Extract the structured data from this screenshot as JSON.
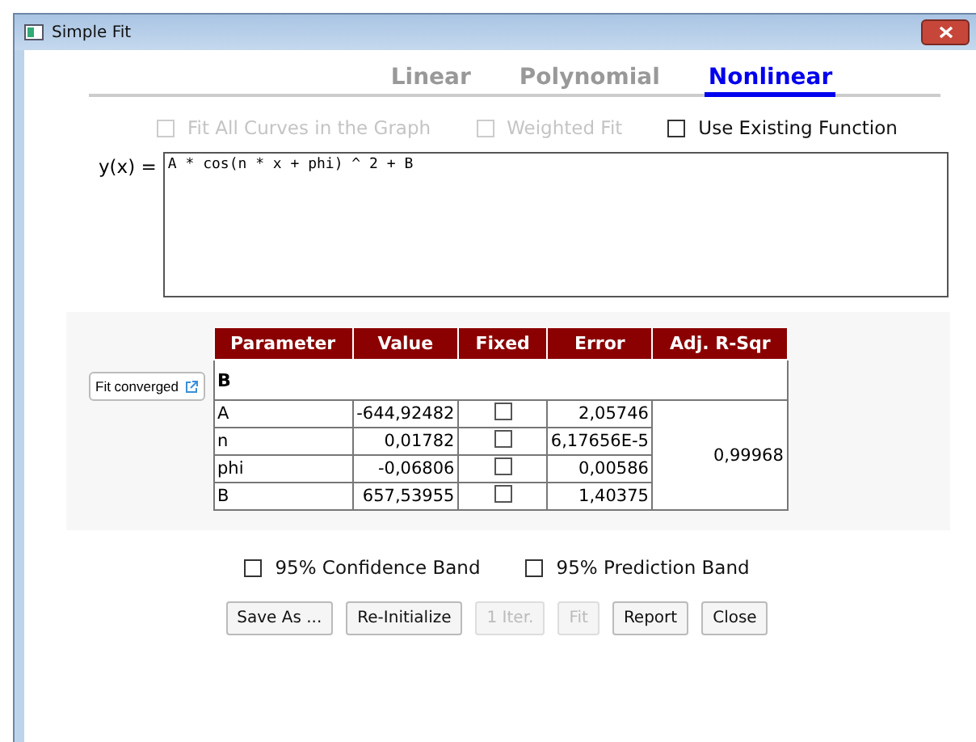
{
  "window": {
    "title": "Simple Fit"
  },
  "tabs": [
    {
      "label": "Linear",
      "selected": false
    },
    {
      "label": "Polynomial",
      "selected": false
    },
    {
      "label": "Nonlinear",
      "selected": true
    }
  ],
  "options": [
    {
      "label": "Fit All Curves in the Graph",
      "checked": false,
      "disabled": true
    },
    {
      "label": "Weighted Fit",
      "checked": false,
      "disabled": true
    },
    {
      "label": "Use Existing Function",
      "checked": false,
      "disabled": false
    }
  ],
  "function": {
    "label": "y(x) =",
    "value": "A * cos(n * x + phi) ^ 2 + B"
  },
  "status_button": "Fit converged",
  "table": {
    "columns": [
      "Parameter",
      "Value",
      "Fixed",
      "Error",
      "Adj. R-Sqr"
    ],
    "group": "B",
    "rows": [
      {
        "parameter": "A",
        "value": "-644,92482",
        "fixed": false,
        "error": "2,05746"
      },
      {
        "parameter": "n",
        "value": "0,01782",
        "fixed": false,
        "error": "6,17656E-5"
      },
      {
        "parameter": "phi",
        "value": "-0,06806",
        "fixed": false,
        "error": "0,00586"
      },
      {
        "parameter": "B",
        "value": "657,53955",
        "fixed": false,
        "error": "1,40375"
      }
    ],
    "adj_r_sqr": "0,99968"
  },
  "bands": [
    {
      "label": "95% Confidence Band",
      "checked": false
    },
    {
      "label": "95% Prediction Band",
      "checked": false
    }
  ],
  "buttons": [
    {
      "label": "Save As ...",
      "disabled": false
    },
    {
      "label": "Re-Initialize",
      "disabled": false
    },
    {
      "label": "1 Iter.",
      "disabled": true
    },
    {
      "label": "Fit",
      "disabled": true
    },
    {
      "label": "Report",
      "disabled": false
    },
    {
      "label": "Close",
      "disabled": false
    }
  ]
}
